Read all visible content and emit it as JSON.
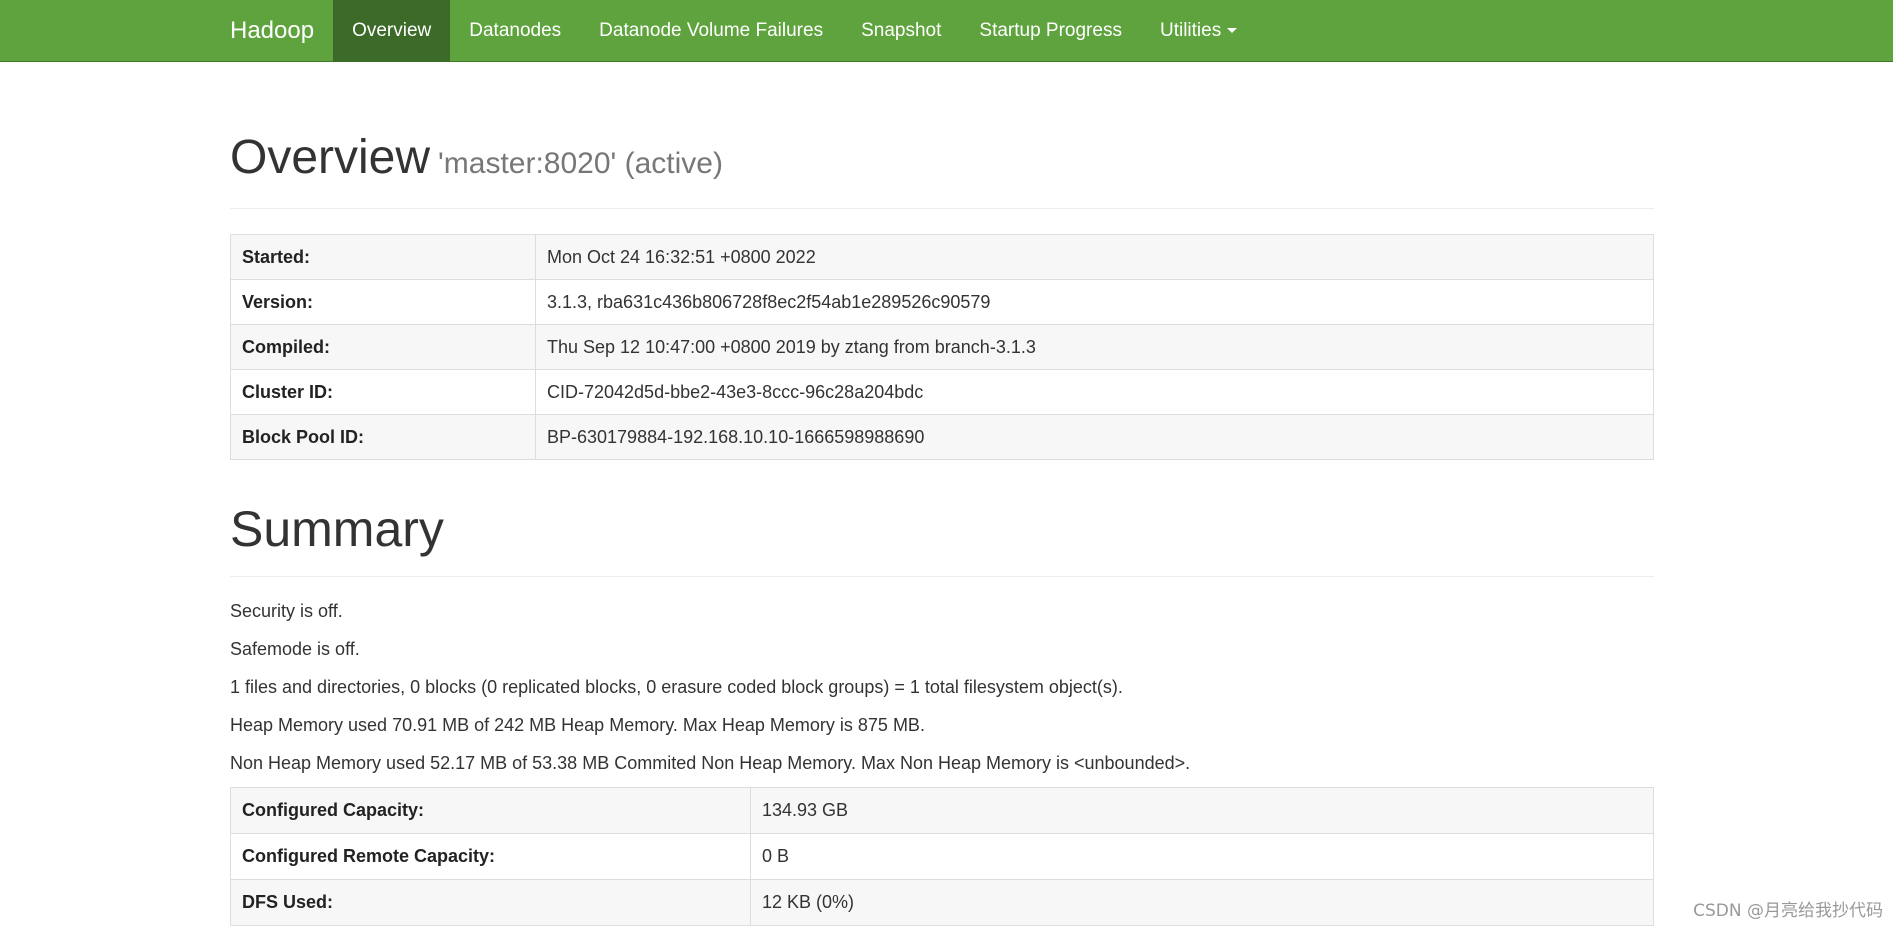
{
  "nav": {
    "brand": "Hadoop",
    "items": [
      {
        "label": "Overview",
        "active": true
      },
      {
        "label": "Datanodes",
        "active": false
      },
      {
        "label": "Datanode Volume Failures",
        "active": false
      },
      {
        "label": "Snapshot",
        "active": false
      },
      {
        "label": "Startup Progress",
        "active": false
      },
      {
        "label": "Utilities",
        "active": false,
        "dropdown": true
      }
    ]
  },
  "overview": {
    "title": "Overview",
    "subtitle": "'master:8020' (active)",
    "rows": [
      {
        "key": "Started:",
        "value": "Mon Oct 24 16:32:51 +0800 2022"
      },
      {
        "key": "Version:",
        "value": "3.1.3, rba631c436b806728f8ec2f54ab1e289526c90579"
      },
      {
        "key": "Compiled:",
        "value": "Thu Sep 12 10:47:00 +0800 2019 by ztang from branch-3.1.3"
      },
      {
        "key": "Cluster ID:",
        "value": "CID-72042d5d-bbe2-43e3-8ccc-96c28a204bdc"
      },
      {
        "key": "Block Pool ID:",
        "value": "BP-630179884-192.168.10.10-1666598988690"
      }
    ]
  },
  "summary": {
    "title": "Summary",
    "lines": [
      "Security is off.",
      "Safemode is off.",
      "1 files and directories, 0 blocks (0 replicated blocks, 0 erasure coded block groups) = 1 total filesystem object(s).",
      "Heap Memory used 70.91 MB of 242 MB Heap Memory. Max Heap Memory is 875 MB.",
      "Non Heap Memory used 52.17 MB of 53.38 MB Commited Non Heap Memory. Max Non Heap Memory is <unbounded>."
    ],
    "capacity_rows": [
      {
        "key": "Configured Capacity:",
        "value": "134.93 GB"
      },
      {
        "key": "Configured Remote Capacity:",
        "value": "0 B"
      },
      {
        "key": "DFS Used:",
        "value": "12 KB (0%)"
      }
    ]
  },
  "watermark": "CSDN @月亮给我抄代码",
  "colors": {
    "navbar": "#5fa33e",
    "navbar_active": "#3c6a29"
  }
}
